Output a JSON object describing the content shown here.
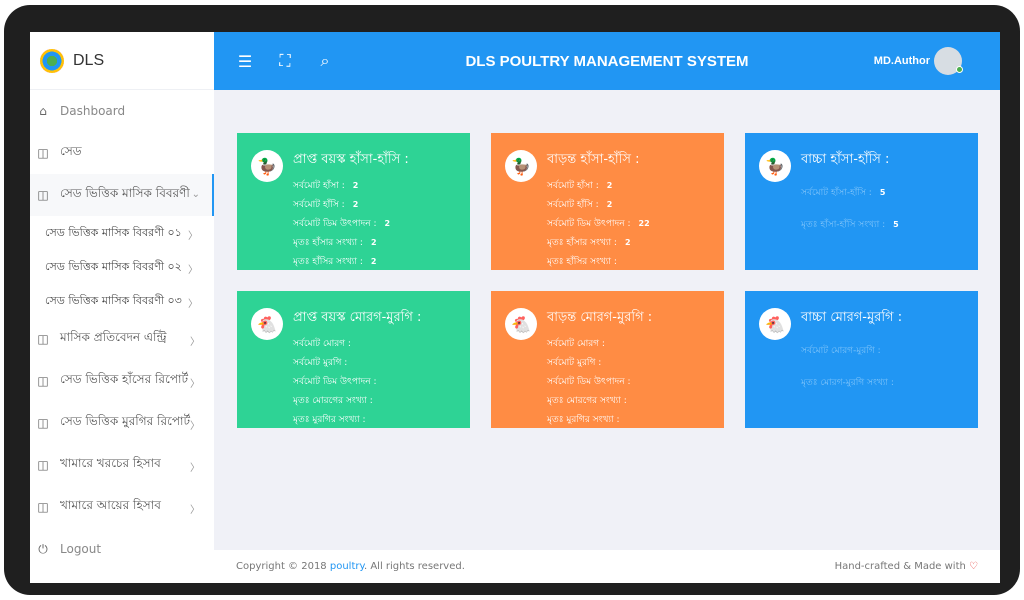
{
  "brand": {
    "name": "DLS"
  },
  "sidebar": {
    "dashboard": "Dashboard",
    "items": [
      {
        "label": "সেড"
      },
      {
        "label": "সেড ভিত্তিক মাসিক বিবরণী"
      },
      {
        "label": "মাসিক প্রতিবেদন এন্ট্রি"
      },
      {
        "label": "সেড ভিত্তিক হাঁসের রিপোর্ট"
      },
      {
        "label": "সেড ভিত্তিক মুরগির রিপোর্ট"
      },
      {
        "label": "খামারে খরচের হিসাব"
      },
      {
        "label": "খামারে আয়ের হিসাব"
      }
    ],
    "subitems": [
      {
        "label": "সেড ভিত্তিক মাসিক বিবরণী ০১"
      },
      {
        "label": "সেড ভিত্তিক মাসিক বিবরণী ০২"
      },
      {
        "label": "সেড ভিত্তিক মাসিক বিবরণী ০৩"
      }
    ],
    "logout": "Logout"
  },
  "header": {
    "title": "DLS POULTRY MANAGEMENT SYSTEM",
    "user": "MD.Author"
  },
  "cards": [
    {
      "title": "প্রাপ্ত বয়স্ক হাঁসা-হাঁসি :",
      "rows": [
        {
          "label": "সর্বমোট হাঁসা :",
          "value": "2"
        },
        {
          "label": "সর্বমোট হাঁসি :",
          "value": "2"
        },
        {
          "label": "সর্বমোট ডিম উৎপাদন :",
          "value": "2"
        },
        {
          "label": "মৃতঃ হাঁসার সংখ্যা :",
          "value": "2"
        },
        {
          "label": "মৃতঃ হাঁসির সংখ্যা :",
          "value": "2"
        }
      ]
    },
    {
      "title": "বাড়ন্ত হাঁসা-হাঁসি :",
      "rows": [
        {
          "label": "সর্বমোট হাঁসা :",
          "value": "2"
        },
        {
          "label": "সর্বমোট হাঁসি :",
          "value": "2"
        },
        {
          "label": "সর্বমোট ডিম উৎপাদন :",
          "value": "22"
        },
        {
          "label": "মৃতঃ হাঁসার সংখ্যা :",
          "value": "2"
        },
        {
          "label": "মৃতঃ হাঁসির সংখ্যা :",
          "value": ""
        }
      ]
    },
    {
      "title": "বাচ্চা হাঁসা-হাঁসি :",
      "rows": [
        {
          "label": "সর্বমোট হাঁসা-হাঁসি :",
          "value": "5"
        },
        {
          "label": "মৃতঃ হাঁসা-হাঁসি সংখ্যা :",
          "value": "5"
        }
      ]
    },
    {
      "title": "প্রাপ্ত বয়স্ক মোরগ-মুরগি :",
      "rows": [
        {
          "label": "সর্বমোট মোরগ :",
          "value": ""
        },
        {
          "label": "সর্বমোট মুরগি :",
          "value": ""
        },
        {
          "label": "সর্বমোট ডিম উৎপাদন :",
          "value": ""
        },
        {
          "label": "মৃতঃ মোরগের সংখ্যা :",
          "value": ""
        },
        {
          "label": "মৃতঃ মুরগির সংখ্যা :",
          "value": ""
        }
      ]
    },
    {
      "title": "বাড়ন্ত মোরগ-মুরগি :",
      "rows": [
        {
          "label": "সর্বমোট মোরগ :",
          "value": ""
        },
        {
          "label": "সর্বমোট মুরগি :",
          "value": ""
        },
        {
          "label": "সর্বমোট ডিম উৎপাদন :",
          "value": ""
        },
        {
          "label": "মৃতঃ মোরগের সংখ্যা :",
          "value": ""
        },
        {
          "label": "মৃতঃ মুরগির সংখ্যা :",
          "value": ""
        }
      ]
    },
    {
      "title": "বাচ্চা মোরগ-মুরগি :",
      "rows": [
        {
          "label": "সর্বমোট মোরগ-মুরগি :",
          "value": ""
        },
        {
          "label": "মৃতঃ মোরগ-মুরগি সংখ্যা :",
          "value": ""
        }
      ]
    }
  ],
  "footer": {
    "copyright": "Copyright © 2018",
    "link": "poultry",
    "rights": ". All rights reserved.",
    "credit": "Hand-crafted & Made with"
  },
  "colors": {
    "header": "#2196f3",
    "green": "#2ed395",
    "orange": "#ff8c44",
    "blue": "#2196f3"
  },
  "icons": {
    "menu": "menu-icon",
    "fullscreen": "fullscreen-icon",
    "search": "search-icon",
    "duck": "duck-icon",
    "chicken": "chicken-icon"
  }
}
